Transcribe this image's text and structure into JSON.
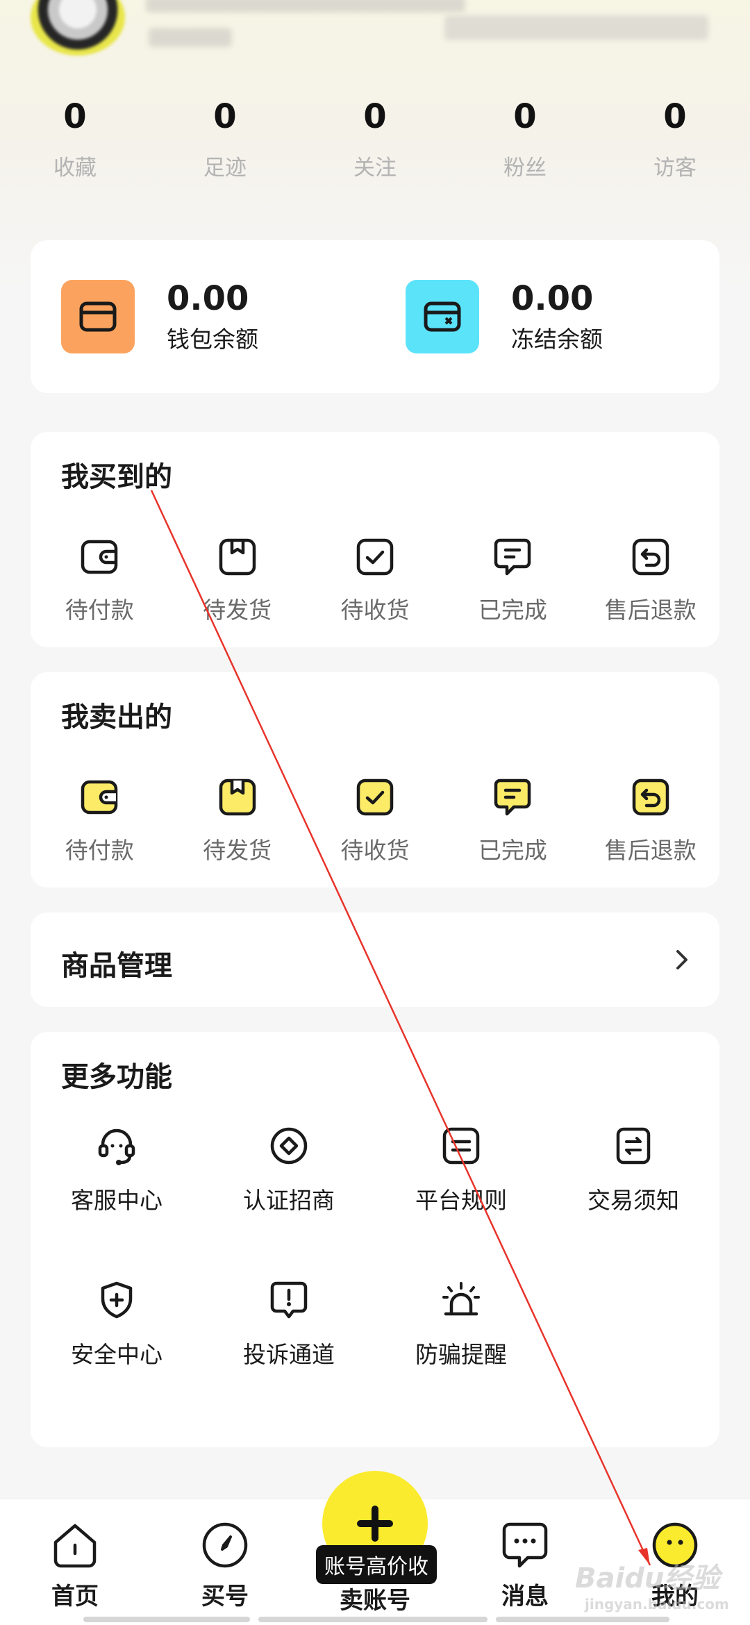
{
  "stats": [
    {
      "value": "0",
      "label": "收藏"
    },
    {
      "value": "0",
      "label": "足迹"
    },
    {
      "value": "0",
      "label": "关注"
    },
    {
      "value": "0",
      "label": "粉丝"
    },
    {
      "value": "0",
      "label": "访客"
    }
  ],
  "wallet": {
    "balance": {
      "amount": "0.00",
      "label": "钱包余额",
      "color": "#fba35e"
    },
    "frozen": {
      "amount": "0.00",
      "label": "冻结余额",
      "color": "#5be3fa"
    }
  },
  "bought": {
    "title": "我买到的",
    "items": [
      {
        "label": "待付款",
        "icon": "wallet-icon"
      },
      {
        "label": "待发货",
        "icon": "package-icon"
      },
      {
        "label": "待收货",
        "icon": "checkbox-icon"
      },
      {
        "label": "已完成",
        "icon": "chat-bubble-icon"
      },
      {
        "label": "售后退款",
        "icon": "return-icon"
      }
    ]
  },
  "sold": {
    "title": "我卖出的",
    "accent": "#fbeb67",
    "items": [
      {
        "label": "待付款",
        "icon": "wallet-icon"
      },
      {
        "label": "待发货",
        "icon": "package-icon"
      },
      {
        "label": "待收货",
        "icon": "checkbox-icon"
      },
      {
        "label": "已完成",
        "icon": "chat-bubble-icon"
      },
      {
        "label": "售后退款",
        "icon": "return-icon"
      }
    ]
  },
  "goods": {
    "title": "商品管理"
  },
  "more": {
    "title": "更多功能",
    "items": [
      {
        "label": "客服中心",
        "icon": "headset-icon"
      },
      {
        "label": "认证招商",
        "icon": "diamond-icon"
      },
      {
        "label": "平台规则",
        "icon": "rules-icon"
      },
      {
        "label": "交易须知",
        "icon": "exchange-icon"
      },
      {
        "label": "安全中心",
        "icon": "shield-icon"
      },
      {
        "label": "投诉通道",
        "icon": "complaint-icon"
      },
      {
        "label": "防骗提醒",
        "icon": "alarm-icon"
      }
    ]
  },
  "nav": {
    "items": [
      {
        "label": "首页",
        "icon": "home-icon"
      },
      {
        "label": "买号",
        "icon": "compass-icon"
      },
      {
        "label": "卖账号",
        "icon": "plus-icon"
      },
      {
        "label": "消息",
        "icon": "message-icon"
      },
      {
        "label": "我的",
        "icon": "face-icon",
        "active": true
      }
    ],
    "sell_tag": "账号高价收",
    "accent": "#fbeb2e"
  },
  "watermark": {
    "main": "Baidu经验",
    "sub": "jingyan.baidu.com"
  }
}
